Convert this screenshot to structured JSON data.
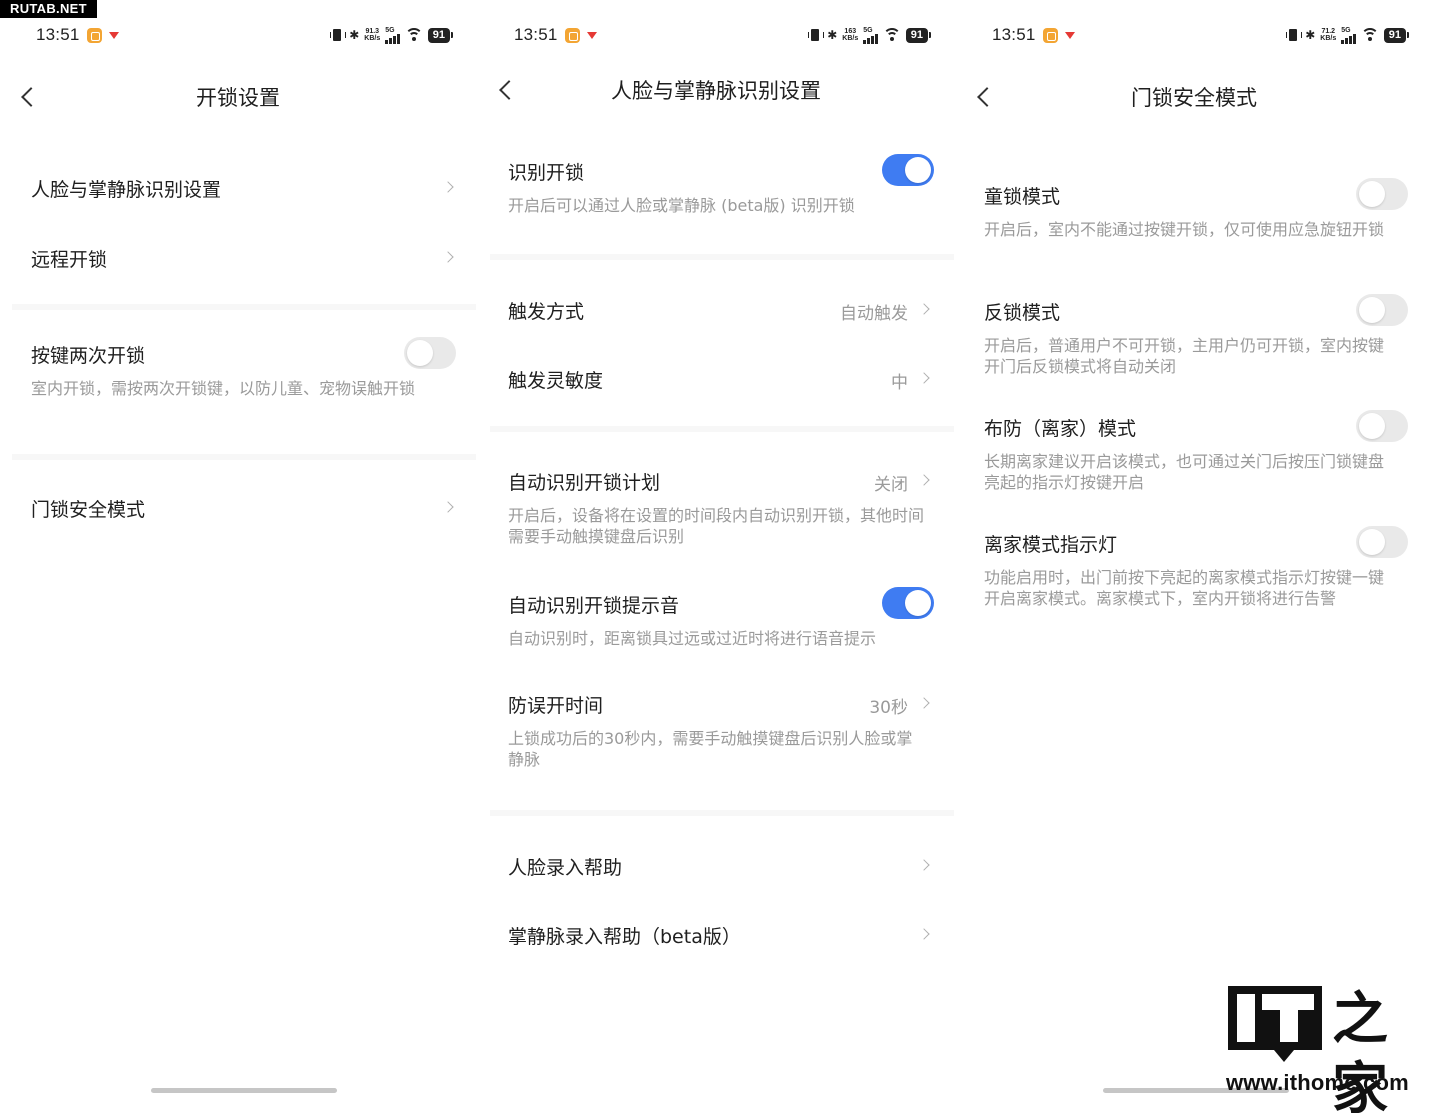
{
  "watermark": "RUTAB.NET",
  "logo": {
    "url": "www.ithome.com",
    "mark": "IT之家"
  },
  "screens": [
    {
      "status": {
        "time": "13:51",
        "speed_value": "91.3",
        "speed_unit": "KB/s",
        "network": "5G",
        "battery": "91"
      },
      "title": "开锁设置",
      "rows": [
        {
          "label": "人脸与掌静脉识别设置"
        },
        {
          "label": "远程开锁"
        },
        {
          "label": "按键两次开锁",
          "toggle": "off",
          "desc": "室内开锁，需按两次开锁键，以防儿童、宠物误触开锁"
        },
        {
          "label": "门锁安全模式"
        }
      ]
    },
    {
      "status": {
        "time": "13:51",
        "speed_value": "163",
        "speed_unit": "KB/s",
        "network": "5G",
        "battery": "91"
      },
      "title": "人脸与掌静脉识别设置",
      "rows": [
        {
          "label": "识别开锁",
          "toggle": "on",
          "desc": "开启后可以通过人脸或掌静脉 (beta版) 识别开锁"
        },
        {
          "label": "触发方式",
          "value": "自动触发"
        },
        {
          "label": "触发灵敏度",
          "value": "中"
        },
        {
          "label": "自动识别开锁计划",
          "value": "关闭",
          "desc": "开启后，设备将在设置的时间段内自动识别开锁，其他时间需要手动触摸键盘后识别"
        },
        {
          "label": "自动识别开锁提示音",
          "toggle": "on",
          "desc": "自动识别时，距离锁具过远或过近时将进行语音提示"
        },
        {
          "label": "防误开时间",
          "value": "30秒",
          "desc": "上锁成功后的30秒内，需要手动触摸键盘后识别人脸或掌静脉"
        },
        {
          "label": "人脸录入帮助"
        },
        {
          "label": "掌静脉录入帮助（beta版）"
        }
      ]
    },
    {
      "status": {
        "time": "13:51",
        "speed_value": "71.2",
        "speed_unit": "KB/s",
        "network": "5G",
        "battery": "91"
      },
      "title": "门锁安全模式",
      "rows": [
        {
          "label": "童锁模式",
          "toggle": "off",
          "desc": "开启后，室内不能通过按键开锁，仅可使用应急旋钮开锁"
        },
        {
          "label": "反锁模式",
          "toggle": "off",
          "desc": "开启后，普通用户不可开锁，主用户仍可开锁，室内按键开门后反锁模式将自动关闭"
        },
        {
          "label": "布防（离家）模式",
          "toggle": "off",
          "desc": "长期离家建议开启该模式，也可通过关门后按压门锁键盘亮起的指示灯按键开启"
        },
        {
          "label": "离家模式指示灯",
          "toggle": "off",
          "desc": "功能启用时，出门前按下亮起的离家模式指示灯按键一键开启离家模式。离家模式下，室内开锁将进行告警"
        }
      ]
    }
  ]
}
